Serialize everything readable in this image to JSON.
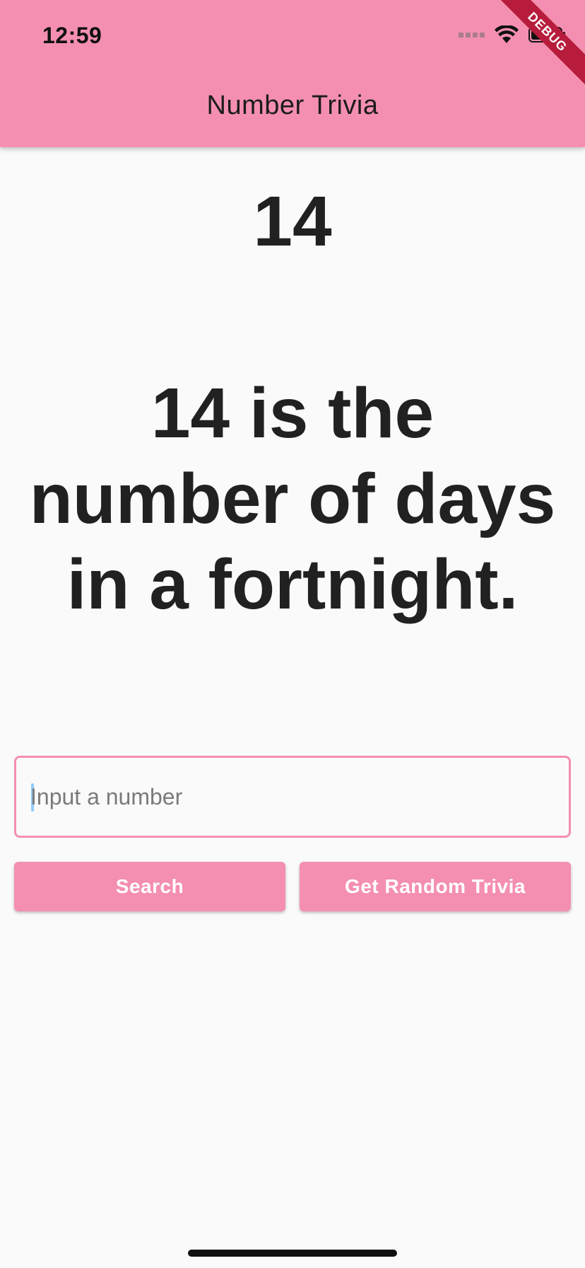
{
  "status_bar": {
    "time": "12:59",
    "icons": [
      "cellular-signal-icon",
      "wifi-icon",
      "battery-icon"
    ]
  },
  "app_bar": {
    "title": "Number Trivia",
    "debug_banner": "DEBUG"
  },
  "trivia": {
    "number": "14",
    "text": "14 is the number of days in a fortnight."
  },
  "input": {
    "placeholder": "Input a number",
    "value": ""
  },
  "buttons": {
    "search": "Search",
    "random": "Get Random Trivia"
  },
  "colors": {
    "primary": "#f48fb1",
    "background": "#fafafa",
    "text": "#212121",
    "debug": "#b71c3c"
  }
}
